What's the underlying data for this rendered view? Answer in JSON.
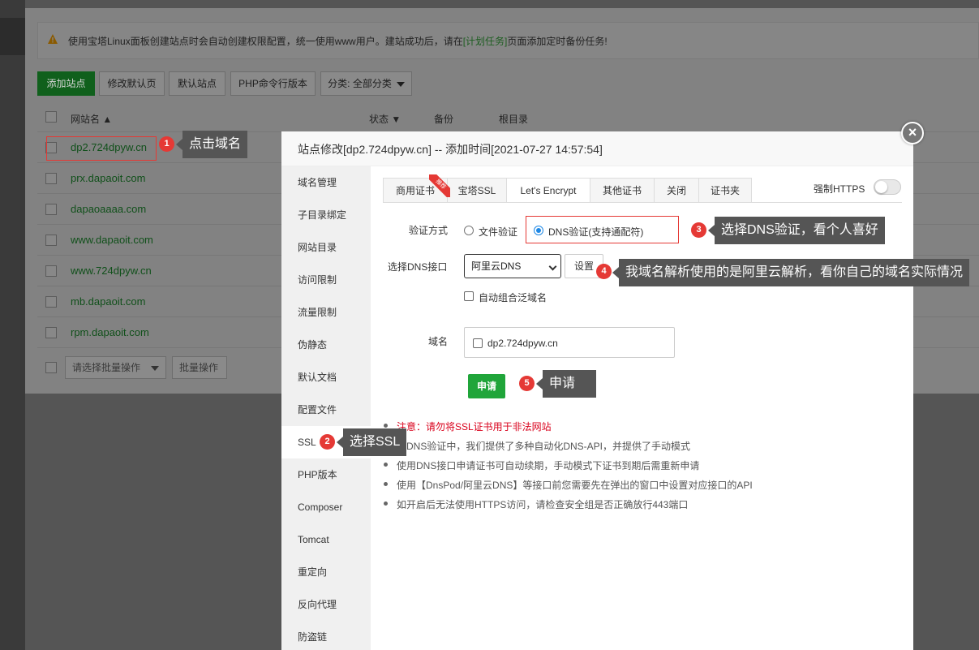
{
  "notice": {
    "before": "使用宝塔Linux面板创建站点时会自动创建权限配置，统一使用www用户。建站成功后，请在",
    "link": "[计划任务]",
    "after": "页面添加定时备份任务!"
  },
  "toolbar": {
    "add_site": "添加站点",
    "edit_default_page": "修改默认页",
    "default_site": "默认站点",
    "php_cli_version": "PHP命令行版本",
    "category": "分类: 全部分类"
  },
  "table": {
    "headers": {
      "site_name": "网站名",
      "status": "状态",
      "backup": "备份",
      "root_dir": "根目录"
    },
    "rows": [
      {
        "site": "dp2.724dpyw.cn"
      },
      {
        "site": "prx.dapaoit.com"
      },
      {
        "site": "dapaoaaaa.com"
      },
      {
        "site": "www.dapaoit.com"
      },
      {
        "site": "www.724dpyw.cn"
      },
      {
        "site": "mb.dapaoit.com"
      },
      {
        "site": "rpm.dapaoit.com"
      }
    ],
    "batch_select_placeholder": "请选择批量操作",
    "batch_button": "批量操作"
  },
  "modal": {
    "title": "站点修改[dp2.724dpyw.cn] -- 添加时间[2021-07-27 14:57:54]",
    "close": "×",
    "nav": [
      "域名管理",
      "子目录绑定",
      "网站目录",
      "访问限制",
      "流量限制",
      "伪静态",
      "默认文档",
      "配置文件",
      "SSL",
      "PHP版本",
      "Composer",
      "Tomcat",
      "重定向",
      "反向代理",
      "防盗链"
    ],
    "active_nav": "SSL",
    "tabs": [
      "商用证书",
      "宝塔SSL",
      "Let's Encrypt",
      "其他证书",
      "关闭",
      "证书夹"
    ],
    "active_tab": "Let's Encrypt",
    "ribbon": "推荐",
    "force_https_label": "强制HTTPS",
    "force_https_on": false,
    "verify_label": "验证方式",
    "verify_file": "文件验证",
    "verify_dns": "DNS验证(支持通配符)",
    "verify_selected": "dns",
    "dns_label": "选择DNS接口",
    "dns_value": "阿里云DNS",
    "dns_settings": "设置",
    "wildcard_label": "自动组合泛域名",
    "domain_label": "域名",
    "domain_value": "dp2.724dpyw.cn",
    "apply": "申请",
    "notes": [
      "注意：请勿将SSL证书用于非法网站",
      "在DNS验证中，我们提供了多种自动化DNS-API，并提供了手动模式",
      "使用DNS接口申请证书可自动续期，手动模式下证书到期后需重新申请",
      "使用【DnsPod/阿里云DNS】等接口前您需要先在弹出的窗口中设置对应接口的API",
      "如开启后无法使用HTTPS访问，请检查安全组是否正确放行443端口"
    ]
  },
  "annotations": [
    {
      "num": "1",
      "text": "点击域名"
    },
    {
      "num": "2",
      "text": "选择SSL"
    },
    {
      "num": "3",
      "text": "选择DNS验证，看个人喜好"
    },
    {
      "num": "4",
      "text": "我域名解析使用的是阿里云解析，看你自己的域名实际情况"
    },
    {
      "num": "5",
      "text": "申请"
    }
  ],
  "colors": {
    "accent": "#20a53a",
    "annotation": "#e53935",
    "callout_bg": "#555555"
  }
}
